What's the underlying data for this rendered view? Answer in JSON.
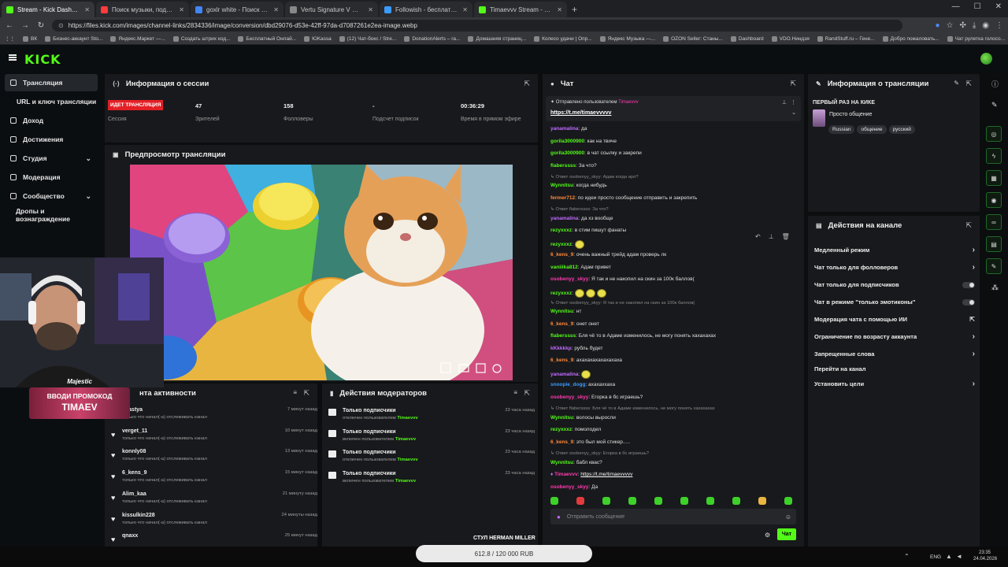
{
  "browser": {
    "tabs": [
      {
        "label": "Stream - Kick Dashboard",
        "color": "#53fc18",
        "active": true
      },
      {
        "label": "Поиск музыки, подкасто",
        "color": "#ff3b3b",
        "active": false
      },
      {
        "label": "goxlr white - Поиск в Google",
        "color": "#4285f4",
        "active": false
      },
      {
        "label": "Vertu Signature V — цены, ку",
        "color": "#888888",
        "active": false
      },
      {
        "label": "Followish - бесплатный сервис",
        "color": "#3b9cff",
        "active": false
      },
      {
        "label": "Timaevvv Stream - Watch Live",
        "color": "#53fc18",
        "active": false
      }
    ],
    "url": "https://files.kick.com/images/channel-links/2834336/image/conversion/dbd29076-d53e-42ff-97da-d7087261e2ea-image.webp",
    "bookmarks": [
      "ВК",
      "Бизнес-аккаунт Sto...",
      "Яндекс.Маркет —...",
      "Создать штрих код...",
      "Бесплатный Онлай...",
      "ЮKassa",
      "(12) Чат-бокс / Stre...",
      "DonationAlerts – ra...",
      "Домашняя страниц...",
      "Колесо удачи | Опр...",
      "Яндекс Музыка —...",
      "OZON Seller: Станы...",
      "Dashboard",
      "VDO.Ниндзя",
      "RandStuff.ru – Гене...",
      "Добро пожаловать...",
      "Чат рулетка голосо..."
    ],
    "all_bookmarks": "Все закладки"
  },
  "kick": {
    "logo": "KICK"
  },
  "sidebar": {
    "items": [
      {
        "label": "Трансляция",
        "icon": "broadcast-icon"
      },
      {
        "label": "URL и ключ трансляции",
        "icon": ""
      },
      {
        "label": "Доход",
        "icon": "money-icon"
      },
      {
        "label": "Достижения",
        "icon": "trophy-icon"
      },
      {
        "label": "Студия",
        "icon": "studio-icon"
      },
      {
        "label": "Модерация",
        "icon": "shield-icon"
      },
      {
        "label": "Сообщество",
        "icon": "community-icon"
      },
      {
        "label": "Дропы и вознаграждение",
        "icon": ""
      }
    ]
  },
  "session": {
    "title": "Информация о сессии",
    "live_badge": "ИДЕТ ТРАНСЛЯЦИЯ",
    "session_label": "Сессия",
    "stats": [
      {
        "value": "47",
        "label": "Зрителей"
      },
      {
        "value": "158",
        "label": "Фолловеры"
      },
      {
        "value": "-",
        "label": "Подсчет подписок"
      },
      {
        "value": "00:36:29",
        "label": "Время в прямом эфире"
      }
    ]
  },
  "preview": {
    "title": "Предпросмотр трансляции"
  },
  "chat": {
    "title": "Чат",
    "pinned_label": "Отправлено пользователем",
    "pinned_user": "Timaevvv",
    "pinned_link": "https://t.me/timaevvvvv",
    "messages": [
      {
        "type": "msg",
        "user": "yanamalina",
        "color": "#c06bff",
        "text": "да"
      },
      {
        "type": "msg",
        "user": "gorila3000900",
        "color": "#53fc18",
        "text": "как на твиче"
      },
      {
        "type": "msg",
        "user": "gorila3000900",
        "color": "#53fc18",
        "text": "в чат ссылку и закрепи"
      },
      {
        "type": "msg",
        "user": "flaberssss",
        "color": "#53fc18",
        "text": "За что?"
      },
      {
        "type": "reply",
        "text": "Ответ osobenyy_skyy: Адам когда ирл?"
      },
      {
        "type": "msg",
        "user": "Wynnitsu",
        "color": "#53fc18",
        "text": "когда нибудь"
      },
      {
        "type": "msg",
        "user": "fermer712",
        "color": "#ff8a3b",
        "text": "по идеи просто сообщение отправить и закрепить"
      },
      {
        "type": "reply",
        "text": "Ответ flaberssss: За что?"
      },
      {
        "type": "msg",
        "user": "yanamalina",
        "color": "#c06bff",
        "text": "да хз вообще"
      },
      {
        "type": "msg",
        "user": "rezyxxxz",
        "color": "#53fc18",
        "text": "в стим пишут фанаты"
      },
      {
        "type": "emote",
        "user": "rezyxxxz",
        "color": "#53fc18",
        "count": 1
      },
      {
        "type": "msg",
        "user": "6_kens_9",
        "color": "#ff8a3b",
        "text": "очень важный трейд адам проверь лк"
      },
      {
        "type": "msg",
        "user": "vaniiika812",
        "color": "#53fc18",
        "text": "Адам привет"
      },
      {
        "type": "msg",
        "user": "osobenyy_skyy",
        "color": "#ff3bb0",
        "text": "Я так и не накопил на скин за 100к баллов("
      },
      {
        "type": "emote",
        "user": "rezyxxxz",
        "color": "#53fc18",
        "count": 3
      },
      {
        "type": "reply",
        "text": "Ответ osobenyy_skyy: Я так и не накопил на скин за 100к баллов("
      },
      {
        "type": "msg",
        "user": "Wynnitsu",
        "color": "#53fc18",
        "text": "нт"
      },
      {
        "type": "msg",
        "user": "6_kens_9",
        "color": "#ff8a3b",
        "text": "онет онет"
      },
      {
        "type": "msg",
        "user": "flaberssss",
        "color": "#53fc18",
        "text": "Бля чё то в Адаме изменилось, не могу понять хахахахах"
      },
      {
        "type": "msg",
        "user": "kKkkkkp",
        "color": "#c06bff",
        "text": "рубль будет"
      },
      {
        "type": "msg",
        "user": "6_kens_9",
        "color": "#ff8a3b",
        "text": "ахахахахахахахаха"
      },
      {
        "type": "emote",
        "user": "yanamalina",
        "color": "#c06bff",
        "count": 1
      },
      {
        "type": "msg",
        "user": "snoopie_dogg",
        "color": "#3b9cff",
        "text": "ахахаххаха"
      },
      {
        "type": "msg",
        "user": "osobenyy_skyy",
        "color": "#ff3bb0",
        "text": "Егорка в бс играешь?"
      },
      {
        "type": "reply",
        "text": "Ответ flaberssss: Бля чё то в Адаме изменилось, не могу понять хахахахах"
      },
      {
        "type": "msg",
        "user": "Wynnitsu",
        "color": "#53fc18",
        "text": "волосы выросли"
      },
      {
        "type": "msg",
        "user": "rezyxxxz",
        "color": "#53fc18",
        "text": "помолодел"
      },
      {
        "type": "msg",
        "user": "6_kens_9",
        "color": "#ff8a3b",
        "text": "это был мой стикер....."
      },
      {
        "type": "reply",
        "text": "Ответ osobenyy_skyy: Егорка в бс играешь?"
      },
      {
        "type": "msg",
        "user": "Wynnitsu",
        "color": "#53fc18",
        "text": "бабл квас?"
      },
      {
        "type": "msg",
        "user": "Timaevvv",
        "color": "#ff3bb0",
        "text": "https://t.me/timaevvvvv",
        "link": true
      },
      {
        "type": "msg",
        "user": "osobenyy_skyy",
        "color": "#ff3bb0",
        "text": "Да"
      }
    ],
    "input_placeholder": "Отправить сообщение",
    "send_label": "Чат"
  },
  "stream_info": {
    "title": "Информация о трансляции",
    "stream_title": "ПЕРВЫЙ РАЗ НА КИКЕ",
    "category": "Просто общение",
    "tags": [
      "Russian",
      "общение",
      "русский"
    ]
  },
  "channel_actions": {
    "title": "Действия на канале",
    "items": [
      {
        "label": "Медленный режим",
        "control": "arrow"
      },
      {
        "label": "Чат только для фолловеров",
        "control": "arrow"
      },
      {
        "label": "Чат только для подписчиков",
        "control": "toggle"
      },
      {
        "label": "Чат в режиме \"только эмотиконы\"",
        "control": "toggle"
      },
      {
        "label": "Модерация чата с помощью ИИ",
        "control": "external"
      },
      {
        "label": "Ограничение по возрасту аккаунта",
        "control": "arrow"
      },
      {
        "label": "Запрещенные слова",
        "control": "arrow"
      },
      {
        "label": "Перейти на канал",
        "control": "none"
      },
      {
        "label": "Установить цели",
        "control": "arrow"
      }
    ]
  },
  "activity": {
    "title": "нта активности",
    "items": [
      {
        "name": "enastya",
        "sub": "только что начал(-а) отслеживать канал",
        "time": "7 минут назад"
      },
      {
        "name": "verget_11",
        "sub": "только что начал(-а) отслеживать канал",
        "time": "10 минут назад"
      },
      {
        "name": "konnly08",
        "sub": "только что начал(-а) отслеживать канал",
        "time": "13 минут назад"
      },
      {
        "name": "6_kens_9",
        "sub": "только что начал(-а) отслеживать канал",
        "time": "15 минут назад"
      },
      {
        "name": "Alim_kaa",
        "sub": "только что начал(-а) отслеживать канал",
        "time": "21 минуту назад"
      },
      {
        "name": "kissulkin228",
        "sub": "только что начал(-а) отслеживать канал",
        "time": "24 минуты назад"
      },
      {
        "name": "qnaxx",
        "sub": "",
        "time": "25 минут назад"
      }
    ]
  },
  "mod_actions": {
    "title": "Действия модераторов",
    "items": [
      {
        "name": "Только подписчики",
        "sub": "отключен пользователем",
        "who": "Timaevvv",
        "time": "23 часа назад"
      },
      {
        "name": "Только подписчики",
        "sub": "включен пользователем",
        "who": "Timaevvv",
        "time": "23 часа назад"
      },
      {
        "name": "Только подписчики",
        "sub": "отключен пользователем",
        "who": "Timaevvv",
        "time": "23 часа назад"
      },
      {
        "name": "Только подписчики",
        "sub": "включен пользователем",
        "who": "Timaevvv",
        "time": "23 часа назад"
      }
    ]
  },
  "overlay": {
    "promo_top": "Majestic",
    "promo_line1": "ВВОДИ ПРОМОКОД",
    "promo_code": "TIMAEV",
    "chair": "СТУЛ HERMAN MILLER",
    "balance": "612.8 / 120 000 RUB"
  },
  "taskbar": {
    "lang": "ENG",
    "time": "23:35",
    "date": "24.04.2026"
  },
  "colors": {
    "accent": "#53fc18",
    "live": "#e31f26",
    "panel": "#18191c",
    "bg": "#0b0e11"
  }
}
